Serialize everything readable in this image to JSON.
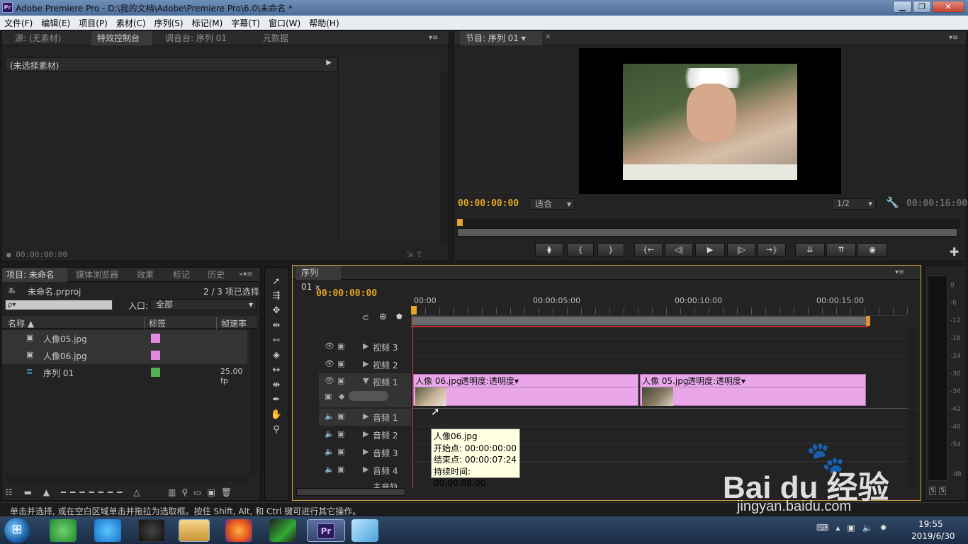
{
  "window": {
    "title": "Adobe Premiere Pro - D:\\我的文档\\Adobe\\Premiere Pro\\6.0\\未命名 *",
    "logo": "Pr",
    "controls": [
      "▁",
      "❐",
      "✕"
    ]
  },
  "menu": [
    "文件(F)",
    "编辑(E)",
    "项目(P)",
    "素材(C)",
    "序列(S)",
    "标记(M)",
    "字幕(T)",
    "窗口(W)",
    "帮助(H)"
  ],
  "source_panel": {
    "tabs": [
      "源: (无素材)",
      "特效控制台",
      "调音台: 序列 01",
      "元数据"
    ],
    "active_tab": 1,
    "no_clip": "(未选择素材)",
    "timecode": "00:00:00:00"
  },
  "program_panel": {
    "tab": "节目: 序列 01",
    "timecode": "00:00:00:00",
    "fit": "适合",
    "resolution": "1/2",
    "duration": "00:00:16:00",
    "buttons": [
      "⧫",
      "{",
      "}",
      "{←",
      "◁|",
      "▶",
      "|▷",
      "→}",
      "⇊",
      "⇈",
      "◉"
    ]
  },
  "project_panel": {
    "tabs": [
      "项目: 未命名",
      "媒体浏览器",
      "效果",
      "标记",
      "历史"
    ],
    "project_file": "未命名.prproj",
    "selected_count": "2 / 3 项已选择",
    "search_placeholder": "ρ▾",
    "in_label": "入口:",
    "in_value": "全部",
    "columns": [
      "名称",
      "标签",
      "帧速率"
    ],
    "items": [
      {
        "name": "人像05.jpg",
        "label_color": "#e08ae0",
        "fps": ""
      },
      {
        "name": "人像06.jpg",
        "label_color": "#e08ae0",
        "fps": ""
      },
      {
        "name": "序列 01",
        "label_color": "#55b055",
        "fps": "25.00 fp"
      }
    ]
  },
  "timeline": {
    "tab": "序列 01",
    "timecode": "00:00:00:00",
    "ruler": [
      "00:00",
      "00:00:05:00",
      "00:00:10:00",
      "00:00:15:00"
    ],
    "tracks": [
      "视频 3",
      "视频 2",
      "视频 1",
      "音频 1",
      "音频 2",
      "音频 3",
      "音频 4",
      "主音轨"
    ],
    "clips": [
      {
        "name": "人像 06.jpg",
        "effect": "透明度:透明度▾"
      },
      {
        "name": "人像 05.jpg",
        "effect": "透明度:透明度▾"
      }
    ],
    "tooltip": {
      "name": "人像06.jpg",
      "start": "开始点: 00:00:00:00",
      "end": "结束点: 00:00:07:24",
      "duration": "持续时间: 00:00:08:00"
    }
  },
  "meter": {
    "unit": "dB",
    "solo": [
      "S",
      "S"
    ]
  },
  "status_bar": "单击并选择, 或在空白区域单击并拖拉为选取框。按住 Shift, Alt, 和 Ctrl 键可进行其它操作。",
  "watermark": {
    "brand": "Bai du 经验",
    "url": "jingyan.baidu.com"
  },
  "taskbar": {
    "time": "19:55",
    "date": "2019/6/30"
  }
}
